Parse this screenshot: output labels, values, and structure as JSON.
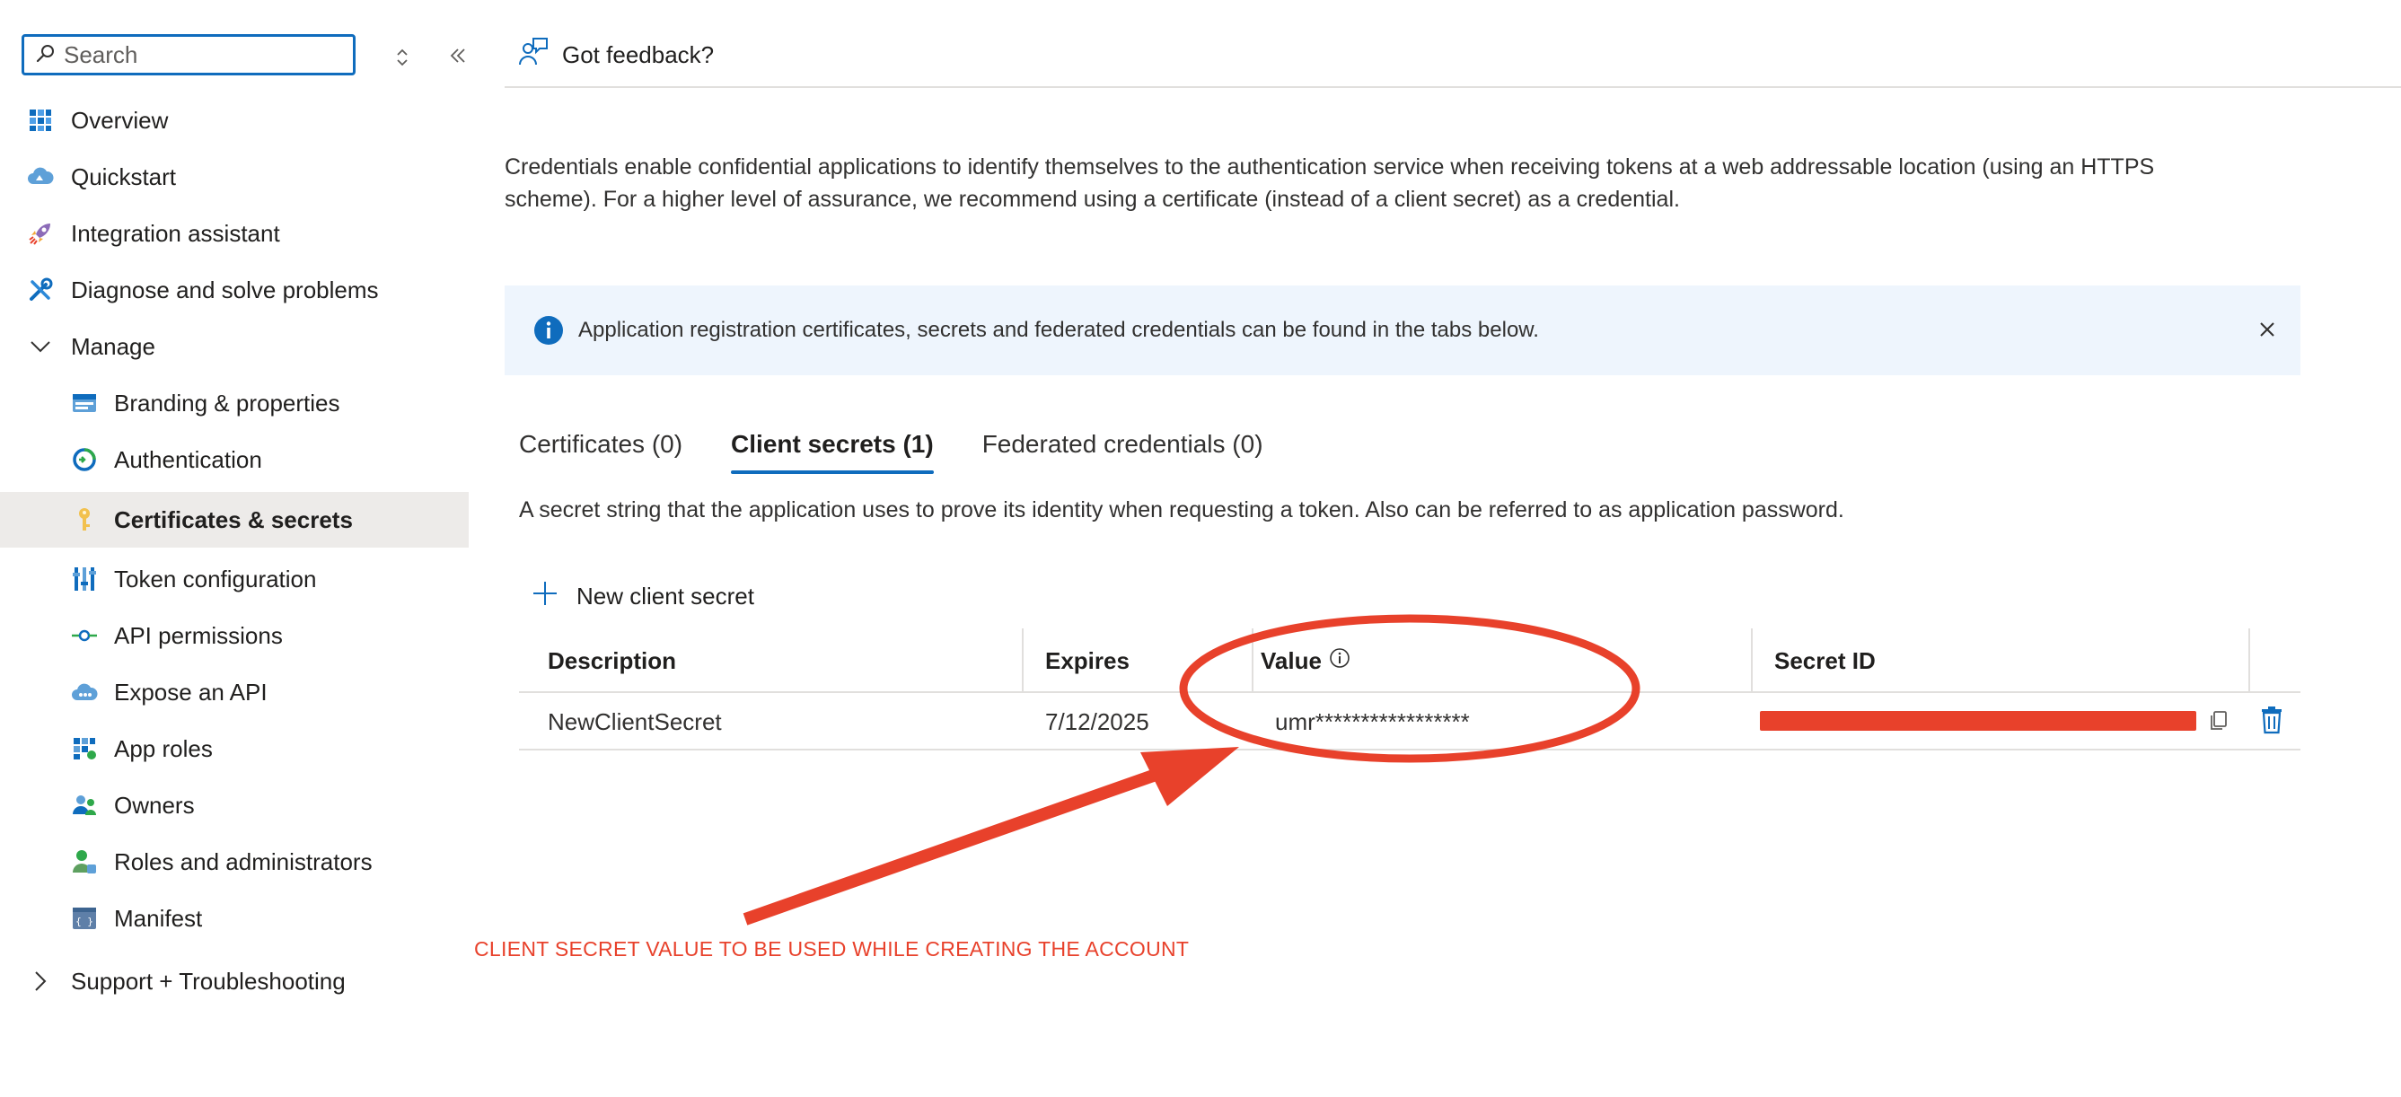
{
  "search": {
    "placeholder": "Search"
  },
  "sidebar": {
    "items": [
      {
        "label": "Overview",
        "icon": "overview-grid-icon"
      },
      {
        "label": "Quickstart",
        "icon": "cloud-quickstart-icon"
      },
      {
        "label": "Integration assistant",
        "icon": "rocket-icon"
      },
      {
        "label": "Diagnose and solve problems",
        "icon": "wrench-icon"
      },
      {
        "label": "Manage",
        "icon": "chevron-down-icon"
      },
      {
        "label": "Branding & properties",
        "icon": "branding-icon"
      },
      {
        "label": "Authentication",
        "icon": "authentication-icon"
      },
      {
        "label": "Certificates & secrets",
        "icon": "key-icon"
      },
      {
        "label": "Token configuration",
        "icon": "token-config-icon"
      },
      {
        "label": "API permissions",
        "icon": "api-permissions-icon"
      },
      {
        "label": "Expose an API",
        "icon": "expose-api-cloud-icon"
      },
      {
        "label": "App roles",
        "icon": "app-roles-grid-icon"
      },
      {
        "label": "Owners",
        "icon": "owners-people-icon"
      },
      {
        "label": "Roles and administrators",
        "icon": "roles-admin-icon"
      },
      {
        "label": "Manifest",
        "icon": "manifest-icon"
      },
      {
        "label": "Support + Troubleshooting",
        "icon": "chevron-right-icon"
      }
    ]
  },
  "toolbar": {
    "feedback_label": "Got feedback?"
  },
  "intro_text": "Credentials enable confidential applications to identify themselves to the authentication service when receiving tokens at a web addressable location (using an HTTPS scheme). For a higher level of assurance, we recommend using a certificate (instead of a client secret) as a credential.",
  "infobar": {
    "message": "Application registration certificates, secrets and federated credentials can be found in the tabs below."
  },
  "tabs": [
    {
      "label": "Certificates (0)",
      "active": false
    },
    {
      "label": "Client secrets (1)",
      "active": true
    },
    {
      "label": "Federated credentials (0)",
      "active": false
    }
  ],
  "tab_description": "A secret string that the application uses to prove its identity when requesting a token. Also can be referred to as application password.",
  "new_secret_label": "New client secret",
  "table": {
    "columns": [
      "Description",
      "Expires",
      "Value",
      "Secret ID"
    ],
    "rows": [
      {
        "description": "NewClientSecret",
        "expires": "7/12/2025",
        "value": "umr*****************",
        "secret_id": ""
      }
    ]
  },
  "annotation": {
    "text": "CLIENT SECRET VALUE TO BE USED WHILE CREATING THE ACCOUNT",
    "color": "#e8412b"
  },
  "colors": {
    "accent": "#0f6cbd",
    "selected_bg": "#edebe9",
    "info_bg": "#eef5fd"
  }
}
